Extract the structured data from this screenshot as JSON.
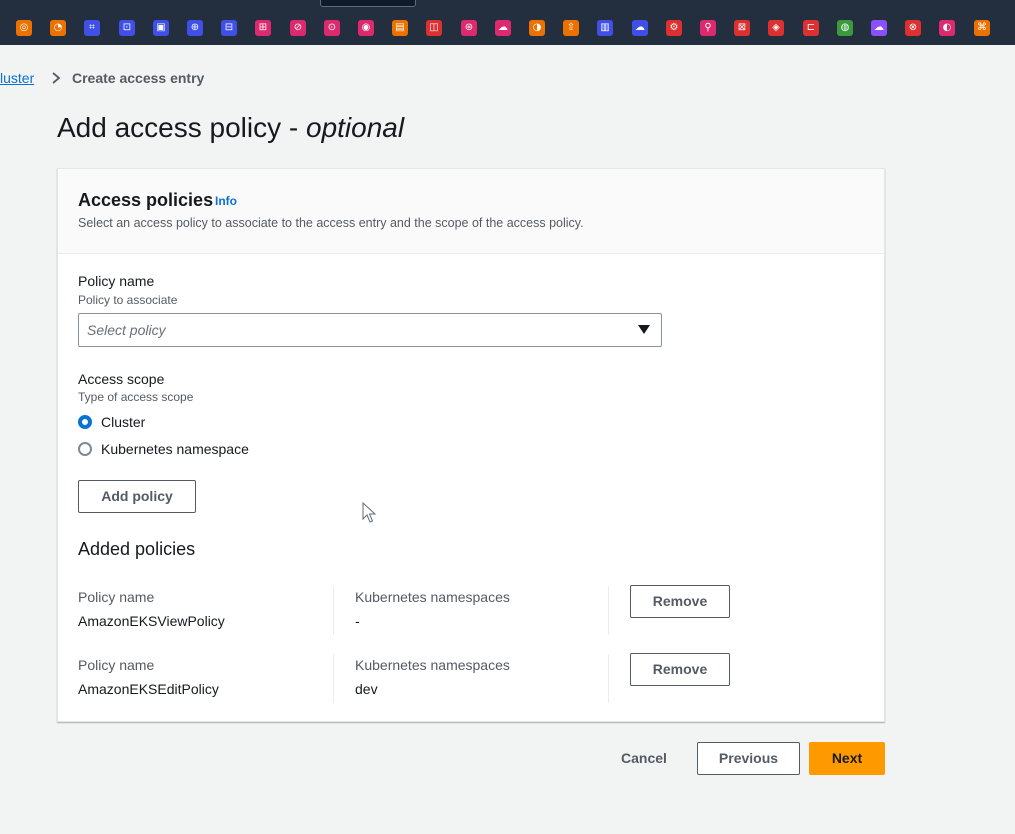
{
  "service_bar": {
    "icons": [
      {
        "name": "service-icon-1",
        "color": "#ed7100",
        "glyph": "◎"
      },
      {
        "name": "service-icon-2",
        "color": "#ed7100",
        "glyph": "◔"
      },
      {
        "name": "service-icon-3",
        "color": "#4050e6",
        "glyph": "⌗"
      },
      {
        "name": "service-icon-4",
        "color": "#4050e6",
        "glyph": "⊡"
      },
      {
        "name": "service-icon-5",
        "color": "#4050e6",
        "glyph": "▣"
      },
      {
        "name": "service-icon-6",
        "color": "#4050e6",
        "glyph": "⊕"
      },
      {
        "name": "service-icon-7",
        "color": "#4050e6",
        "glyph": "⊟"
      },
      {
        "name": "service-icon-8",
        "color": "#dd2a6e",
        "glyph": "⊞"
      },
      {
        "name": "service-icon-9",
        "color": "#dd2a6e",
        "glyph": "⊘"
      },
      {
        "name": "service-icon-10",
        "color": "#dd2a6e",
        "glyph": "⊙"
      },
      {
        "name": "service-icon-11",
        "color": "#dd2a6e",
        "glyph": "◉"
      },
      {
        "name": "service-icon-12",
        "color": "#ed7100",
        "glyph": "▤"
      },
      {
        "name": "service-icon-13",
        "color": "#dd3031",
        "glyph": "◫"
      },
      {
        "name": "service-icon-14",
        "color": "#dd2a6e",
        "glyph": "⊛"
      },
      {
        "name": "service-icon-15",
        "color": "#dd2a6e",
        "glyph": "☁"
      },
      {
        "name": "service-icon-16",
        "color": "#ed7100",
        "glyph": "◑"
      },
      {
        "name": "service-icon-17",
        "color": "#ed7100",
        "glyph": "⇧"
      },
      {
        "name": "service-icon-18",
        "color": "#4050e6",
        "glyph": "▥"
      },
      {
        "name": "service-icon-19",
        "color": "#4050e6",
        "glyph": "☁"
      },
      {
        "name": "service-icon-20",
        "color": "#dd3031",
        "glyph": "⚙"
      },
      {
        "name": "service-icon-21",
        "color": "#dd2a6e",
        "glyph": "⚲"
      },
      {
        "name": "service-icon-22",
        "color": "#dd3031",
        "glyph": "⊠"
      },
      {
        "name": "service-icon-23",
        "color": "#dd3031",
        "glyph": "◈"
      },
      {
        "name": "service-icon-24",
        "color": "#dd3031",
        "glyph": "⊏"
      },
      {
        "name": "service-icon-25",
        "color": "#3b9a3b",
        "glyph": "◍"
      },
      {
        "name": "service-icon-26",
        "color": "#8c4fff",
        "glyph": "☁"
      },
      {
        "name": "service-icon-27",
        "color": "#dd3031",
        "glyph": "⊗"
      },
      {
        "name": "service-icon-28",
        "color": "#dd2a6e",
        "glyph": "◐"
      },
      {
        "name": "service-icon-29",
        "color": "#ed7100",
        "glyph": "⌘"
      }
    ]
  },
  "breadcrumb": {
    "parent": "luster",
    "current": "Create access entry"
  },
  "page": {
    "title": "Add access policy - ",
    "title_suffix": "optional"
  },
  "access_policies": {
    "title": "Access policies",
    "info": "Info",
    "description": "Select an access policy to associate to the access entry and the scope of the access policy.",
    "policy_name_label": "Policy name",
    "policy_name_desc": "Policy to associate",
    "policy_placeholder": "Select policy",
    "scope_label": "Access scope",
    "scope_desc": "Type of access scope",
    "scope_options": [
      {
        "label": "Cluster",
        "checked": true
      },
      {
        "label": "Kubernetes namespace",
        "checked": false
      }
    ],
    "add_button": "Add policy"
  },
  "added_policies": {
    "title": "Added policies",
    "col_policy": "Policy name",
    "col_namespaces": "Kubernetes namespaces",
    "remove_label": "Remove",
    "rows": [
      {
        "policy": "AmazonEKSViewPolicy",
        "namespaces": "-"
      },
      {
        "policy": "AmazonEKSEditPolicy",
        "namespaces": "dev"
      }
    ]
  },
  "footer": {
    "cancel": "Cancel",
    "previous": "Previous",
    "next": "Next"
  },
  "colors": {
    "accent": "#0972d3",
    "primary_button": "#ff9900",
    "topbar": "#232f3e"
  }
}
